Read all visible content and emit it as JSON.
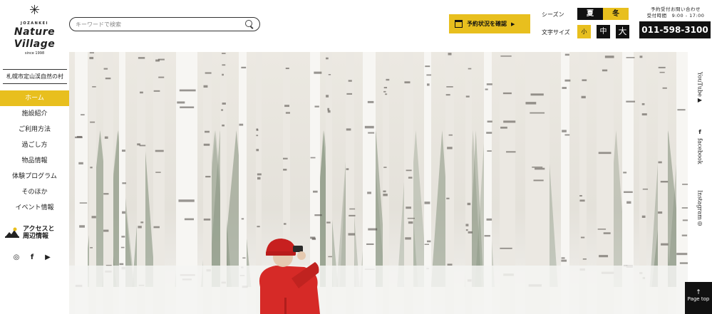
{
  "logo": {
    "small": "JOZANKEI",
    "line1": "Nature",
    "line2": "Village",
    "since": "since 1998"
  },
  "village_name": "札幌市定山渓自然の村",
  "nav": [
    {
      "label": "ホーム",
      "active": true
    },
    {
      "label": "施設紹介"
    },
    {
      "label": "ご利用方法"
    },
    {
      "label": "過ごし方"
    },
    {
      "label": "物品情報"
    },
    {
      "label": "体験プログラム"
    },
    {
      "label": "そのほか"
    },
    {
      "label": "イベント情報"
    }
  ],
  "access": {
    "line1": "アクセスと",
    "line2": "周辺情報"
  },
  "social_icons": [
    "instagram-icon",
    "facebook-icon",
    "youtube-icon"
  ],
  "search": {
    "placeholder": "キーワードで検索"
  },
  "reserve": {
    "label": "予約状況を確認",
    "arrow": "▶"
  },
  "season": {
    "label": "シーズン",
    "summer": "夏",
    "winter": "冬",
    "selected": "冬"
  },
  "font_size": {
    "label": "文字サイズ",
    "small": "小",
    "medium": "中",
    "large": "大",
    "selected": "小"
  },
  "contact": {
    "line1": "予約受付お問い合わせ",
    "line2": "受付時間　9:00 - 17:00",
    "phone": "011-598-3100"
  },
  "rail": {
    "youtube": "YouTube",
    "facebook": "facebook",
    "instagram": "Instagram",
    "youtube_icon": "▶",
    "facebook_icon": "f",
    "instagram_icon": "◎"
  },
  "pagetop": {
    "arrow": "↑",
    "label": "Page top"
  },
  "colors": {
    "accent": "#e8bf1e",
    "dark": "#111111",
    "jacket": "#d62a27"
  }
}
